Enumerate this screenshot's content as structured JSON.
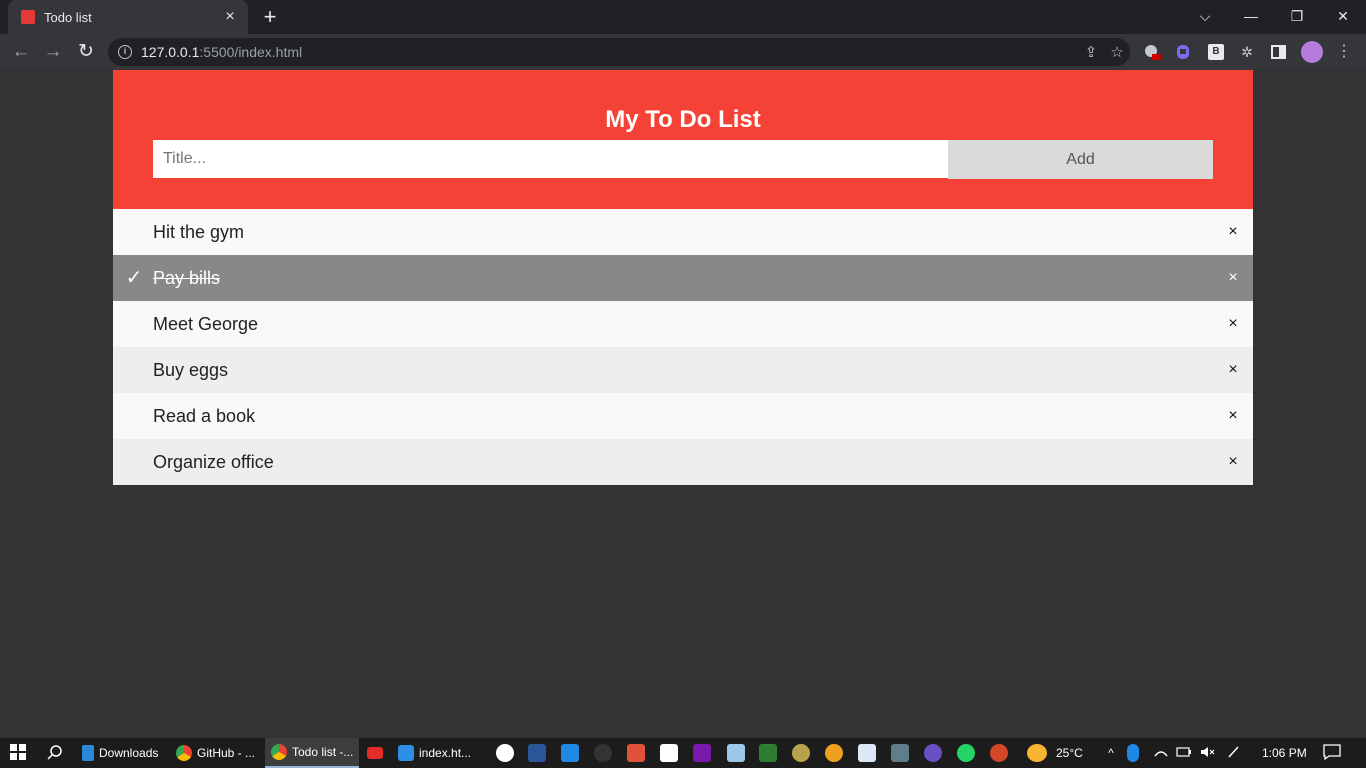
{
  "browser": {
    "tab_title": "Todo list",
    "tab_close": "×",
    "new_tab": "+",
    "window_controls": {
      "dropdown": "⌵",
      "minimize": "—",
      "restore": "❐",
      "close": "✕"
    },
    "nav": {
      "back": "←",
      "forward": "→",
      "reload": "↻"
    },
    "url_host": "127.0.0.1",
    "url_rest": ":5500/index.html",
    "info_icon": "i",
    "share_icon": "⇪",
    "bookmark_icon": "☆",
    "extension_b_label": "B",
    "puzzle_icon": "✲",
    "sidepanel_icon": "▮",
    "menu_icon": "⋮"
  },
  "app": {
    "title": "My To Do List",
    "input_placeholder": "Title...",
    "add_label": "Add",
    "close_symbol": "×",
    "check_symbol": "✓",
    "items": [
      {
        "text": "Hit the gym",
        "checked": false
      },
      {
        "text": "Pay bills",
        "checked": true
      },
      {
        "text": "Meet George",
        "checked": false
      },
      {
        "text": "Buy eggs",
        "checked": false
      },
      {
        "text": "Read a book",
        "checked": false
      },
      {
        "text": "Organize office",
        "checked": false
      }
    ],
    "colors": {
      "header": "#f44336",
      "checked_row": "#888888",
      "odd_row": "#f9f9f9",
      "even_row": "#eeeeee"
    }
  },
  "taskbar": {
    "apps": [
      {
        "label": "Downloads",
        "icon": "download-icon"
      },
      {
        "label": "GitHub - ...",
        "icon": "chrome-icon"
      },
      {
        "label": "Todo list -...",
        "icon": "chrome-icon",
        "active": true
      },
      {
        "label": "index.ht...",
        "icon": "vscode-icon"
      }
    ],
    "weather": "25°C",
    "time": "1:06 PM"
  }
}
